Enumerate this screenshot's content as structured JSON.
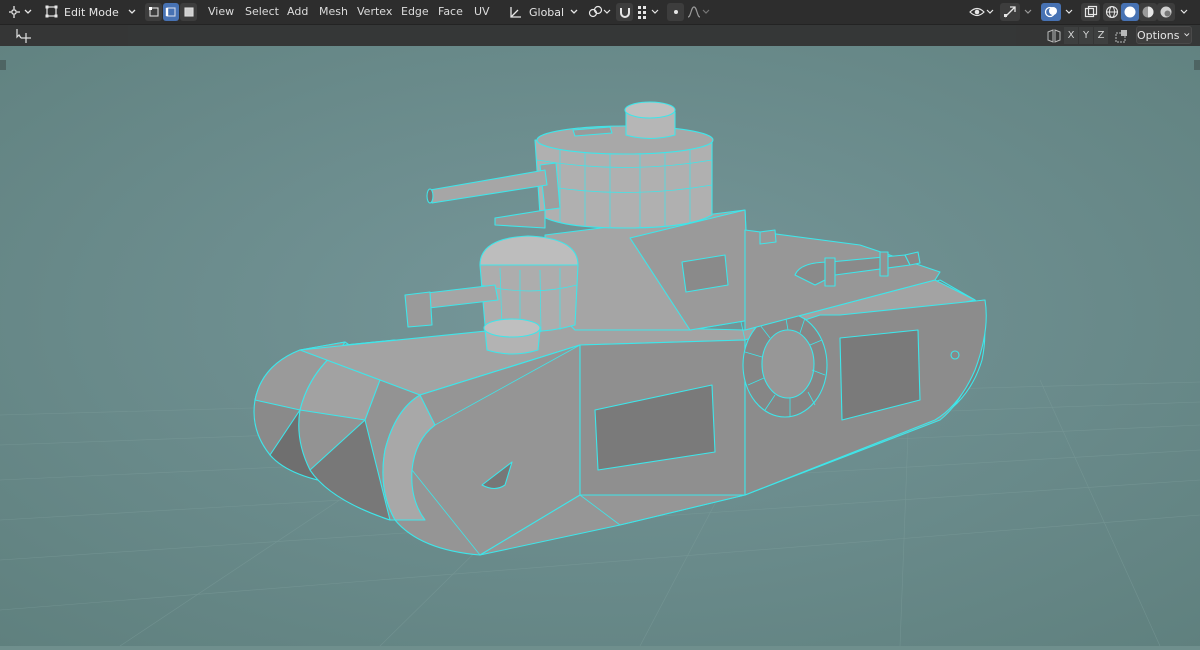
{
  "header": {
    "mode": "Edit Mode",
    "menus": [
      "View",
      "Select",
      "Add",
      "Mesh",
      "Vertex",
      "Edge",
      "Face",
      "UV"
    ],
    "transform_orientation": "Global"
  },
  "toolbar": {
    "axes": [
      "X",
      "Y",
      "Z"
    ],
    "options_label": "Options"
  },
  "colors": {
    "header_bg": "#2d2d2d",
    "viewport_bg": "#6f8f8d",
    "wire": "#3ee6ea",
    "mesh_face": "#8c8c8c",
    "active_button": "#4772b3"
  },
  "icons": [
    "editor-type-icon",
    "mode-icon",
    "vertex-select-icon",
    "edge-select-icon",
    "face-select-icon",
    "transform-orientation-icon",
    "pivot-icon",
    "snap-icon",
    "snap-grid-icon",
    "proportional-edit-icon",
    "falloff-icon",
    "visibility-icon",
    "gizmo-icon",
    "overlay-icon",
    "xray-icon",
    "wireframe-shading-icon",
    "solid-shading-icon",
    "material-shading-icon",
    "rendered-shading-icon",
    "move-cursor-icon",
    "mirror-icon",
    "auto-merge-icon"
  ]
}
